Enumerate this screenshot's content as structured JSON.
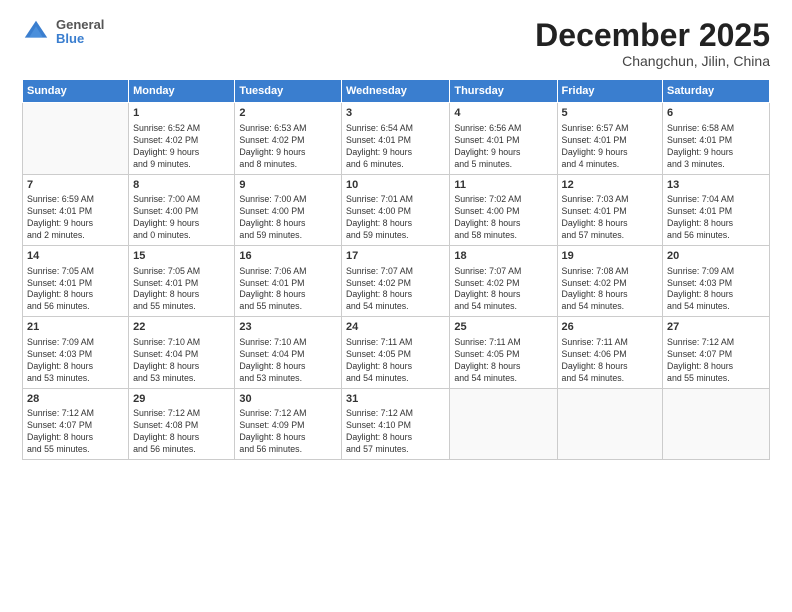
{
  "header": {
    "logo": {
      "general": "General",
      "blue": "Blue"
    },
    "title": "December 2025",
    "location": "Changchun, Jilin, China"
  },
  "days_of_week": [
    "Sunday",
    "Monday",
    "Tuesday",
    "Wednesday",
    "Thursday",
    "Friday",
    "Saturday"
  ],
  "weeks": [
    [
      {
        "day": "",
        "info": ""
      },
      {
        "day": "1",
        "info": "Sunrise: 6:52 AM\nSunset: 4:02 PM\nDaylight: 9 hours\nand 9 minutes."
      },
      {
        "day": "2",
        "info": "Sunrise: 6:53 AM\nSunset: 4:02 PM\nDaylight: 9 hours\nand 8 minutes."
      },
      {
        "day": "3",
        "info": "Sunrise: 6:54 AM\nSunset: 4:01 PM\nDaylight: 9 hours\nand 6 minutes."
      },
      {
        "day": "4",
        "info": "Sunrise: 6:56 AM\nSunset: 4:01 PM\nDaylight: 9 hours\nand 5 minutes."
      },
      {
        "day": "5",
        "info": "Sunrise: 6:57 AM\nSunset: 4:01 PM\nDaylight: 9 hours\nand 4 minutes."
      },
      {
        "day": "6",
        "info": "Sunrise: 6:58 AM\nSunset: 4:01 PM\nDaylight: 9 hours\nand 3 minutes."
      }
    ],
    [
      {
        "day": "7",
        "info": "Sunrise: 6:59 AM\nSunset: 4:01 PM\nDaylight: 9 hours\nand 2 minutes."
      },
      {
        "day": "8",
        "info": "Sunrise: 7:00 AM\nSunset: 4:00 PM\nDaylight: 9 hours\nand 0 minutes."
      },
      {
        "day": "9",
        "info": "Sunrise: 7:00 AM\nSunset: 4:00 PM\nDaylight: 8 hours\nand 59 minutes."
      },
      {
        "day": "10",
        "info": "Sunrise: 7:01 AM\nSunset: 4:00 PM\nDaylight: 8 hours\nand 59 minutes."
      },
      {
        "day": "11",
        "info": "Sunrise: 7:02 AM\nSunset: 4:00 PM\nDaylight: 8 hours\nand 58 minutes."
      },
      {
        "day": "12",
        "info": "Sunrise: 7:03 AM\nSunset: 4:01 PM\nDaylight: 8 hours\nand 57 minutes."
      },
      {
        "day": "13",
        "info": "Sunrise: 7:04 AM\nSunset: 4:01 PM\nDaylight: 8 hours\nand 56 minutes."
      }
    ],
    [
      {
        "day": "14",
        "info": "Sunrise: 7:05 AM\nSunset: 4:01 PM\nDaylight: 8 hours\nand 56 minutes."
      },
      {
        "day": "15",
        "info": "Sunrise: 7:05 AM\nSunset: 4:01 PM\nDaylight: 8 hours\nand 55 minutes."
      },
      {
        "day": "16",
        "info": "Sunrise: 7:06 AM\nSunset: 4:01 PM\nDaylight: 8 hours\nand 55 minutes."
      },
      {
        "day": "17",
        "info": "Sunrise: 7:07 AM\nSunset: 4:02 PM\nDaylight: 8 hours\nand 54 minutes."
      },
      {
        "day": "18",
        "info": "Sunrise: 7:07 AM\nSunset: 4:02 PM\nDaylight: 8 hours\nand 54 minutes."
      },
      {
        "day": "19",
        "info": "Sunrise: 7:08 AM\nSunset: 4:02 PM\nDaylight: 8 hours\nand 54 minutes."
      },
      {
        "day": "20",
        "info": "Sunrise: 7:09 AM\nSunset: 4:03 PM\nDaylight: 8 hours\nand 54 minutes."
      }
    ],
    [
      {
        "day": "21",
        "info": "Sunrise: 7:09 AM\nSunset: 4:03 PM\nDaylight: 8 hours\nand 53 minutes."
      },
      {
        "day": "22",
        "info": "Sunrise: 7:10 AM\nSunset: 4:04 PM\nDaylight: 8 hours\nand 53 minutes."
      },
      {
        "day": "23",
        "info": "Sunrise: 7:10 AM\nSunset: 4:04 PM\nDaylight: 8 hours\nand 53 minutes."
      },
      {
        "day": "24",
        "info": "Sunrise: 7:11 AM\nSunset: 4:05 PM\nDaylight: 8 hours\nand 54 minutes."
      },
      {
        "day": "25",
        "info": "Sunrise: 7:11 AM\nSunset: 4:05 PM\nDaylight: 8 hours\nand 54 minutes."
      },
      {
        "day": "26",
        "info": "Sunrise: 7:11 AM\nSunset: 4:06 PM\nDaylight: 8 hours\nand 54 minutes."
      },
      {
        "day": "27",
        "info": "Sunrise: 7:12 AM\nSunset: 4:07 PM\nDaylight: 8 hours\nand 55 minutes."
      }
    ],
    [
      {
        "day": "28",
        "info": "Sunrise: 7:12 AM\nSunset: 4:07 PM\nDaylight: 8 hours\nand 55 minutes."
      },
      {
        "day": "29",
        "info": "Sunrise: 7:12 AM\nSunset: 4:08 PM\nDaylight: 8 hours\nand 56 minutes."
      },
      {
        "day": "30",
        "info": "Sunrise: 7:12 AM\nSunset: 4:09 PM\nDaylight: 8 hours\nand 56 minutes."
      },
      {
        "day": "31",
        "info": "Sunrise: 7:12 AM\nSunset: 4:10 PM\nDaylight: 8 hours\nand 57 minutes."
      },
      {
        "day": "",
        "info": ""
      },
      {
        "day": "",
        "info": ""
      },
      {
        "day": "",
        "info": ""
      }
    ]
  ]
}
